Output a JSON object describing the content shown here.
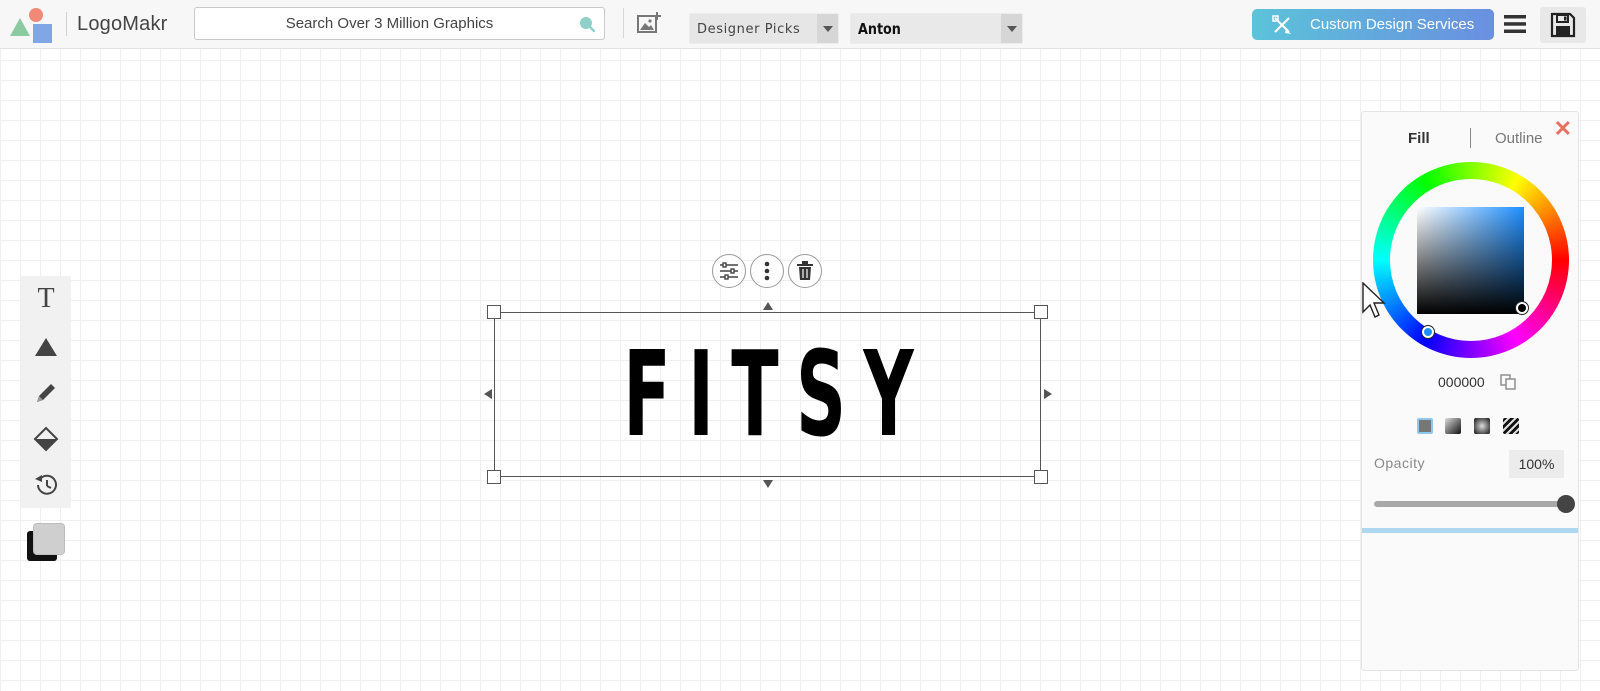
{
  "header": {
    "brand": "LogoMakr",
    "search_placeholder": "Search Over 3 Million Graphics",
    "category_select": "Designer Picks",
    "font_select": "Anton",
    "cta_label": "Custom Design Services"
  },
  "canvas": {
    "text": "FITSY"
  },
  "color_panel": {
    "tab_fill": "Fill",
    "tab_outline": "Outline",
    "hex": "000000",
    "opacity_label": "Opacity",
    "opacity_value": "100%",
    "opacity_fraction": 1.0
  },
  "colors": {
    "cta_start": "#5bc3d9",
    "cta_end": "#6a8fe0",
    "close_accent": "#e87060",
    "fill_color": "#000000"
  }
}
